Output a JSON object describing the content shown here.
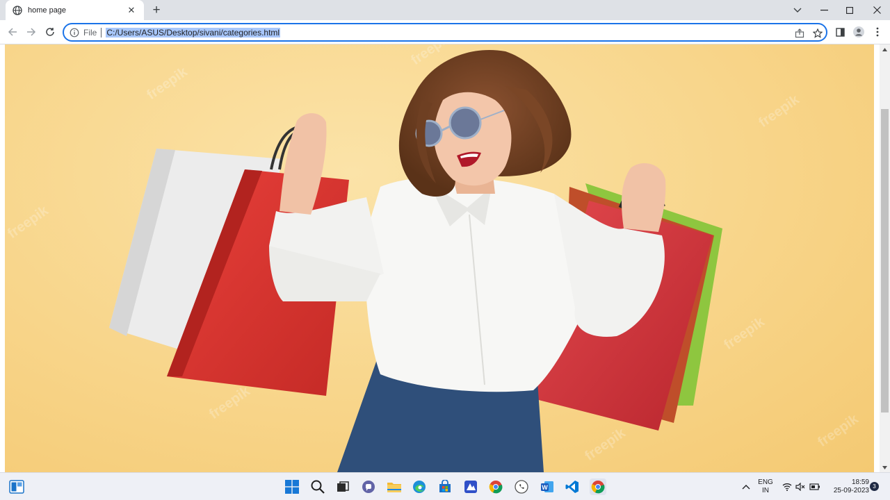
{
  "browser": {
    "tab": {
      "title": "home page",
      "close_glyph": "✕"
    },
    "newtab_glyph": "+",
    "window_controls": {
      "dropdown": "⌄",
      "minimize": "—",
      "maximize": "☐",
      "close": "✕"
    },
    "omnibox": {
      "scheme_label": "File",
      "url": "C:/Users/ASUS/Desktop/sivani/categories.html"
    }
  },
  "page": {
    "hero_image": {
      "description_icon": "shopping-woman-photo",
      "watermark": "freepik",
      "colors": {
        "background": "#f8d58a",
        "shirt": "#ffffff",
        "jeans": "#2f4f7a",
        "bag_red": "#d8312c",
        "bag_white": "#eeeeee",
        "bag_green": "#8ec63f"
      }
    }
  },
  "taskbar": {
    "language": {
      "line1": "ENG",
      "line2": "IN"
    },
    "clock": {
      "time": "18:59",
      "date": "25-09-2023"
    },
    "notification_count": "3",
    "pinned": [
      "start-icon",
      "search-icon",
      "task-view-icon",
      "teams-chat-icon",
      "file-explorer-icon",
      "edge-icon",
      "store-icon",
      "photos-icon",
      "chrome-icon",
      "whatsapp-icon",
      "word-icon",
      "vscode-icon",
      "chrome-active-icon"
    ]
  },
  "accent": "#1a73e8"
}
